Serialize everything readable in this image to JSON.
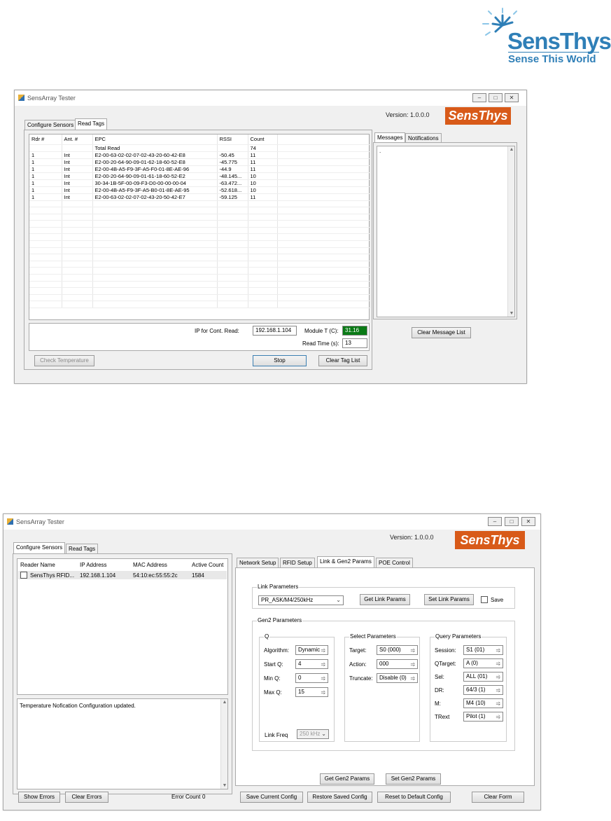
{
  "brand": {
    "name": "SensThys",
    "tagline": "Sense This World"
  },
  "w1": {
    "title": "SensArray Tester",
    "version": "Version: 1.0.0.0",
    "badge": "SensThys",
    "tabs": [
      "Configure Sensors",
      "Read Tags"
    ],
    "columns": [
      "Rdr #",
      "Ant. #",
      "EPC",
      "RSSI",
      "Count"
    ],
    "total_label": "Total Read",
    "total_count": "74",
    "rows": [
      [
        "1",
        "Int",
        "E2-00-63-02-02-07-02-43-20-60-42-E8",
        "-50.45",
        "11"
      ],
      [
        "1",
        "Int",
        "E2-00-20-64-90-09-01-62-18-60-52-E8",
        "-45.775",
        "11"
      ],
      [
        "1",
        "Int",
        "E2-00-4B-A5-F9-3F-A5-F0-01-8E-AE-96",
        "-44.9",
        "11"
      ],
      [
        "1",
        "Int",
        "E2-00-20-64-90-09-01-61-18-60-52-E2",
        "-48.145...",
        "10"
      ],
      [
        "1",
        "Int",
        "30-34-1B-5F-00-09-F3-D0-00-00-00-04",
        "-63.472...",
        "10"
      ],
      [
        "1",
        "Int",
        "E2-00-4B-A5-F9-3F-A5-B0-01-8E-AE-95",
        "-52.618...",
        "10"
      ],
      [
        "1",
        "Int",
        "E2-00-63-02-02-07-02-43-20-50-42-E7",
        "-59.125",
        "11"
      ]
    ],
    "ip_label": "IP for Cont. Read:",
    "ip_value": "192.168.1.104",
    "module_label": "Module T (C):",
    "module_value": "31.16",
    "readtime_label": "Read Time (s):",
    "readtime_value": "13",
    "check_temp": "Check Temperature",
    "stop": "Stop",
    "clear_tags": "Clear Tag List",
    "msg_tabs": [
      "Messages",
      "Notifications"
    ],
    "msg_text": ".",
    "clear_msgs": "Clear Message List"
  },
  "w2": {
    "title": "SensArray Tester",
    "version": "Version: 1.0.0.0",
    "badge": "SensThys",
    "tabs": [
      "Configure Sensors",
      "Read Tags"
    ],
    "reader_columns": [
      "Reader Name",
      "IP Address",
      "MAC Address",
      "Active Count"
    ],
    "reader_row": [
      "SensThys RFID...",
      "192.168.1.104",
      "54:10:ec:55:55:2c",
      "1584"
    ],
    "log_text": "Temperature Nofication Configuration updated.",
    "show_errors": "Show Errors",
    "clear_errors": "Clear Errors",
    "error_count_label": "Error Count",
    "error_count": "0",
    "right_tabs": [
      "Network Setup",
      "RFID Setup",
      "Link & Gen2 Params",
      "POE Control"
    ],
    "link_group": "Link Parameters",
    "link_select": "PR_ASK/M4/250kHz",
    "get_link": "Get Link Params",
    "set_link": "Set Link Params",
    "save": "Save",
    "gen2_group": "Gen2 Parameters",
    "q_group": "Q",
    "q_fields": [
      {
        "label": "Algorithm:",
        "value": "Dynamic"
      },
      {
        "label": "Start Q:",
        "value": "4"
      },
      {
        "label": "Min Q:",
        "value": "0"
      },
      {
        "label": "Max Q:",
        "value": "15"
      }
    ],
    "link_freq_label": "Link Freq",
    "link_freq_value": "250 kHz",
    "select_group": "Select Parameters",
    "select_fields": [
      {
        "label": "Target:",
        "value": "S0 (000)"
      },
      {
        "label": "Action:",
        "value": "000"
      },
      {
        "label": "Truncate:",
        "value": "Disable (0)"
      }
    ],
    "query_group": "Query Parameters",
    "query_fields": [
      {
        "label": "Session:",
        "value": "S1 (01)"
      },
      {
        "label": "QTarget:",
        "value": "A (0)"
      },
      {
        "label": "Sel:",
        "value": "ALL (01)"
      },
      {
        "label": "DR:",
        "value": "64/3 (1)"
      },
      {
        "label": "M:",
        "value": "M4 (10)"
      },
      {
        "label": "TRext",
        "value": "Pilot (1)"
      }
    ],
    "get_gen2": "Get Gen2 Params",
    "set_gen2": "Set Gen2 Params",
    "save_config": "Save Current Config",
    "restore_config": "Restore Saved Config",
    "reset_config": "Reset to Default Config",
    "clear_form": "Clear Form"
  },
  "colors": {
    "brand_blue": "#2f7fb7",
    "badge_orange": "#d85a19",
    "temp_green": "#0a7a16"
  }
}
